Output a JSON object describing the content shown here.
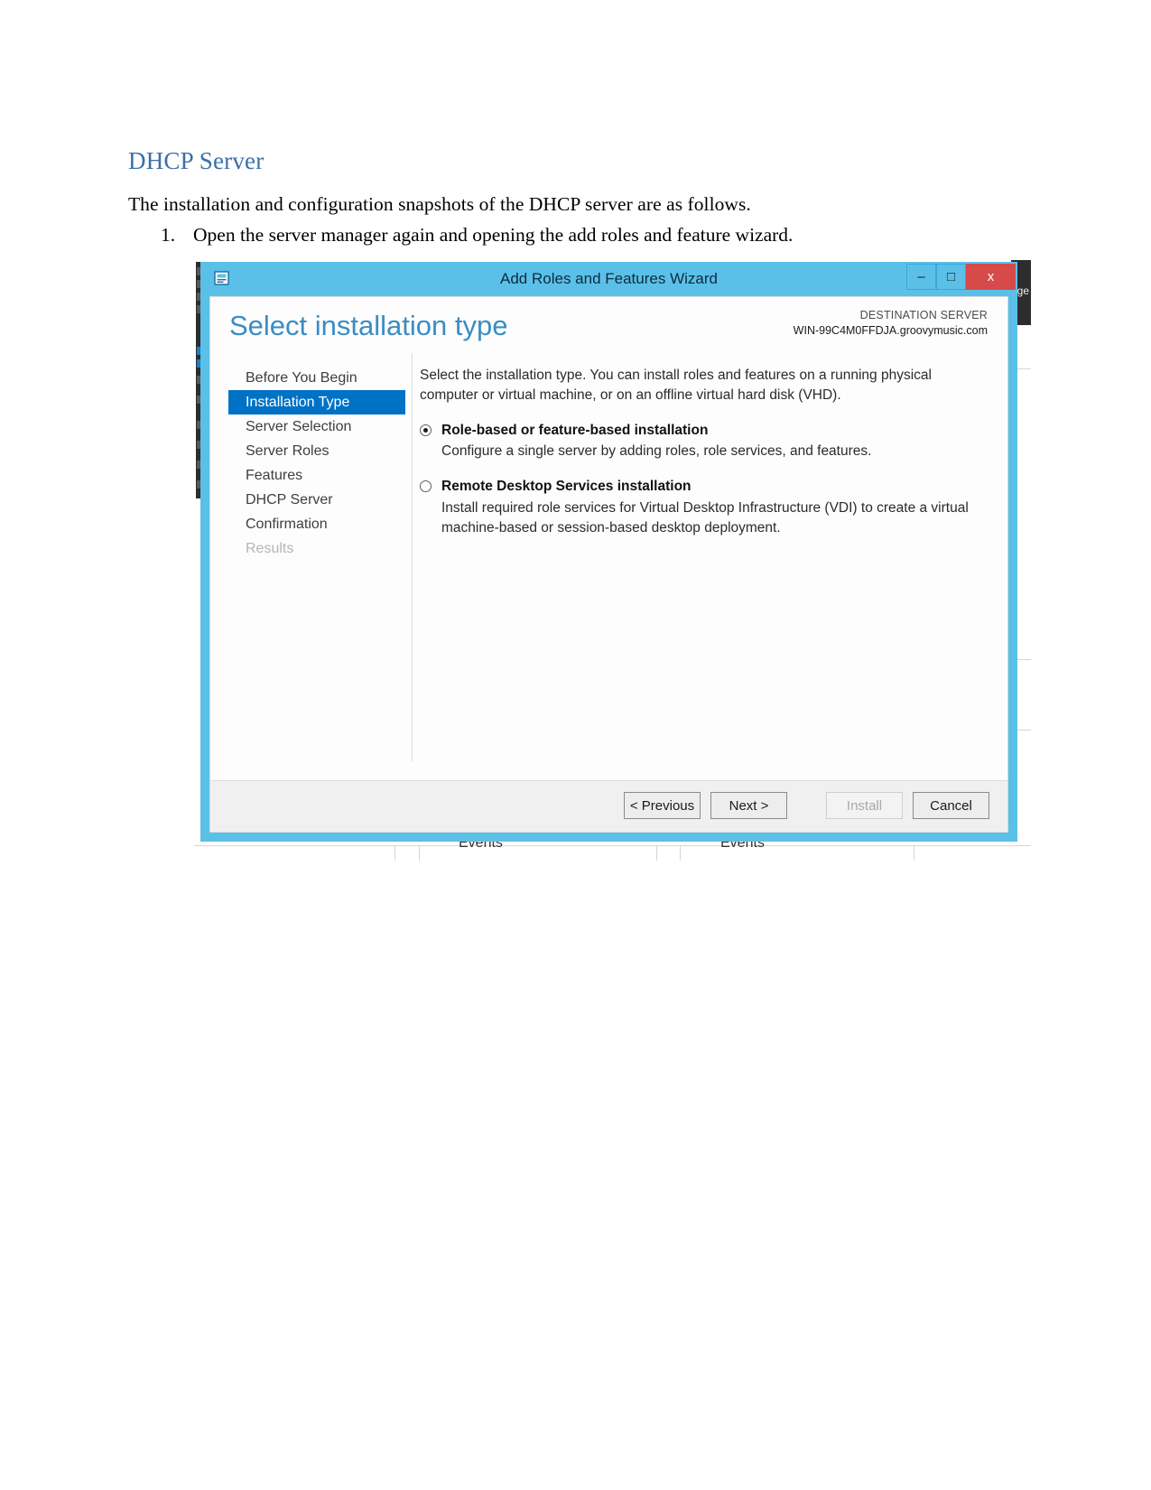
{
  "document": {
    "heading": "DHCP Server",
    "paragraph": "The installation and configuration snapshots of the DHCP server are as follows.",
    "list": [
      {
        "marker": "1.",
        "text": "Open the server manager again and opening the add roles and feature wizard."
      }
    ]
  },
  "wizard": {
    "titlebar": {
      "icon": "wizard-window-icon",
      "title": "Add Roles and Features Wizard",
      "minimize": "–",
      "maximize": "□",
      "close": "x"
    },
    "header": {
      "page_title": "Select installation type",
      "destination_label": "DESTINATION SERVER",
      "destination_server": "WIN-99C4M0FFDJA.groovymusic.com"
    },
    "nav": [
      {
        "label": "Before You Begin",
        "state": "normal"
      },
      {
        "label": "Installation Type",
        "state": "active"
      },
      {
        "label": "Server Selection",
        "state": "normal"
      },
      {
        "label": "Server Roles",
        "state": "normal"
      },
      {
        "label": "Features",
        "state": "normal"
      },
      {
        "label": "DHCP Server",
        "state": "normal"
      },
      {
        "label": "Confirmation",
        "state": "normal"
      },
      {
        "label": "Results",
        "state": "disabled"
      }
    ],
    "content": {
      "intro": "Select the installation type. You can install roles and features on a running physical computer or virtual machine, or on an offline virtual hard disk (VHD).",
      "options": [
        {
          "title": "Role-based or feature-based installation",
          "description": "Configure a single server by adding roles, role services, and features.",
          "selected": true
        },
        {
          "title": "Remote Desktop Services installation",
          "description": "Install required role services for Virtual Desktop Infrastructure (VDI) to create a virtual machine-based or session-based desktop deployment.",
          "selected": false
        }
      ]
    },
    "footer": {
      "previous": "< Previous",
      "next": "Next >",
      "install": "Install",
      "cancel": "Cancel"
    }
  },
  "background": {
    "right_tab_label": "ge",
    "events_left": "Events",
    "events_right": "Events"
  },
  "colors": {
    "heading": "#3c6ea8",
    "wizard_chrome": "#5bc0e8",
    "nav_active": "#0072c6",
    "title_accent": "#3a8dc4",
    "close_button": "#d64a4a"
  }
}
